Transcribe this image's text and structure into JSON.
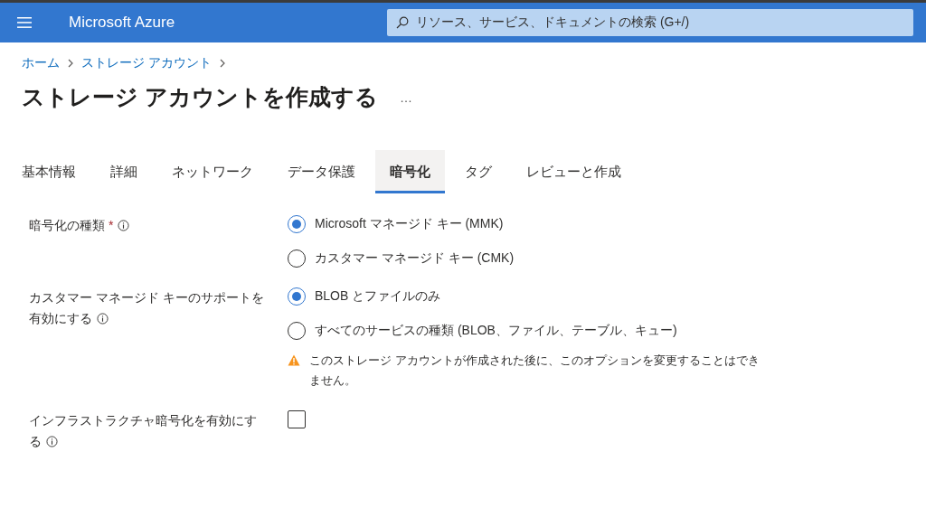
{
  "header": {
    "brand": "Microsoft Azure",
    "search": {
      "placeholder": "リソース、サービス、ドキュメントの検索 (G+/)"
    }
  },
  "breadcrumb": [
    "ホーム",
    "ストレージ アカウント"
  ],
  "page_title": "ストレージ アカウントを作成する",
  "more": "…",
  "tabs": [
    {
      "label": "基本情報",
      "selected": false
    },
    {
      "label": "詳細",
      "selected": false
    },
    {
      "label": "ネットワーク",
      "selected": false
    },
    {
      "label": "データ保護",
      "selected": false
    },
    {
      "label": "暗号化",
      "selected": true
    },
    {
      "label": "タグ",
      "selected": false
    },
    {
      "label": "レビューと作成",
      "selected": false
    }
  ],
  "fields": [
    {
      "kind": "radio",
      "label": "暗号化の種類",
      "required_mark": "*",
      "options": [
        {
          "label": "Microsoft マネージド キー (MMK)",
          "selected": true
        },
        {
          "label": "カスタマー マネージド キー (CMK)",
          "selected": false
        }
      ]
    },
    {
      "kind": "radio",
      "label": "カスタマー マネージド キーのサポートを有効にする",
      "options": [
        {
          "label": "BLOB とファイルのみ",
          "selected": true
        },
        {
          "label": "すべてのサービスの種類 (BLOB、ファイル、テーブル、キュー)",
          "selected": false
        }
      ],
      "warning": "このストレージ アカウントが作成された後に、このオプションを変更することはできません。"
    },
    {
      "kind": "checkbox",
      "label": "インフラストラクチャ暗号化を有効にする",
      "checked": false
    }
  ]
}
